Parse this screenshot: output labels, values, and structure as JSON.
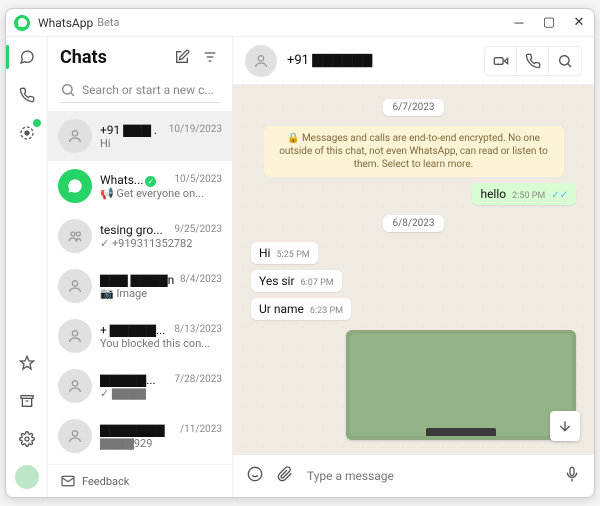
{
  "titlebar": {
    "app": "WhatsApp",
    "beta": "Beta"
  },
  "sidebar": {
    "heading": "Chats",
    "search_placeholder": "Search or start a new c...",
    "feedback": "Feedback"
  },
  "chats": [
    {
      "name": "+91 ▇▇▇ .",
      "date": "10/19/2023",
      "preview": "Hi",
      "avatar": "person",
      "selected": true
    },
    {
      "name": "Whats...",
      "date": "10/5/2023",
      "preview": "📢 Get everyone on...",
      "avatar": "whatsapp",
      "verified": true
    },
    {
      "name": "tesing gro...",
      "date": "9/25/2023",
      "preview": "✓ +919311352782",
      "avatar": "group"
    },
    {
      "name": "▇▇▇ ▇▇▇▇n",
      "date": "8/4/2023",
      "preview": "📷 Image",
      "avatar": "person"
    },
    {
      "name": "+ ▇▇▇▇▇...",
      "date": "8/13/2023",
      "preview": "You blocked this con...",
      "avatar": "person"
    },
    {
      "name": "▇▇▇▇▇...",
      "date": "7/28/2023",
      "preview": "✓ ▇▇▇▇",
      "avatar": "person"
    },
    {
      "name": "▇▇▇▇▇▇▇",
      "date": "/11/2023",
      "preview": "▇▇▇▇929",
      "avatar": "person"
    }
  ],
  "conversation": {
    "title": "+91 ▇▇▇▇▇▇",
    "encryption_note": "🔒 Messages and calls are end-to-end encrypted. No one outside of this chat, not even WhatsApp, can read or listen to them. Select to learn more.",
    "days": [
      {
        "label": "6/7/2023",
        "messages": [
          {
            "dir": "out",
            "text": "hello",
            "time": "2:50 PM",
            "ticks": true
          }
        ]
      },
      {
        "label": "6/8/2023",
        "messages": [
          {
            "dir": "in",
            "text": "Hi",
            "time": "5:25 PM"
          },
          {
            "dir": "in",
            "text": "Yes sir",
            "time": "6:07 PM"
          },
          {
            "dir": "in",
            "text": "Ur name",
            "time": "6:23 PM"
          }
        ]
      }
    ]
  },
  "composer": {
    "placeholder": "Type a message"
  }
}
